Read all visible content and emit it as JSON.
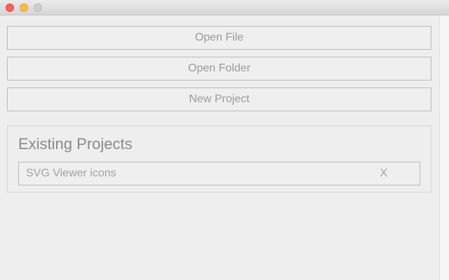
{
  "window": {
    "controls": {
      "close": "close",
      "minimize": "minimize",
      "zoom": "zoom"
    }
  },
  "actions": {
    "open_file": "Open File",
    "open_folder": "Open Folder",
    "new_project": "New Project"
  },
  "projects": {
    "title": "Existing Projects",
    "items": [
      {
        "name": "SVG Viewer icons",
        "remove_label": "X"
      }
    ]
  },
  "colors": {
    "close": "#fc605b",
    "minimize": "#fdbc40",
    "zoom_inactive": "#cfcfcf"
  }
}
